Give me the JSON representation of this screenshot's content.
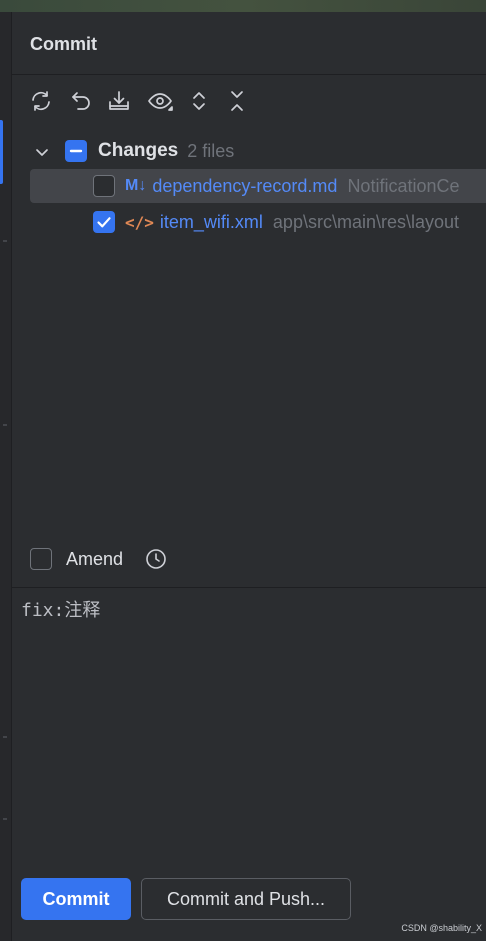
{
  "panel": {
    "title": "Commit"
  },
  "toolbar": {
    "items": [
      "refresh-icon",
      "rollback-icon",
      "shelve-icon",
      "eye-icon",
      "expand-all-icon",
      "collapse-all-icon"
    ]
  },
  "tree": {
    "group": {
      "label": "Changes",
      "count": "2 files"
    },
    "files": [
      {
        "name": "dependency-record.md",
        "icon_text": "M↓",
        "path": "NotificationCe",
        "checked": false
      },
      {
        "name": "item_wifi.xml",
        "icon_text": "</>",
        "path": "app\\src\\main\\res\\layout",
        "checked": true
      }
    ]
  },
  "amend": {
    "label": "Amend"
  },
  "message": {
    "text": "fix:注释"
  },
  "buttons": {
    "commit": "Commit",
    "commit_and_push": "Commit and Push..."
  },
  "watermark": "CSDN @shability_X",
  "colors": {
    "accent": "#3574f0",
    "link": "#548af7",
    "xml_icon": "#e08855",
    "bg": "#2b2d30"
  }
}
